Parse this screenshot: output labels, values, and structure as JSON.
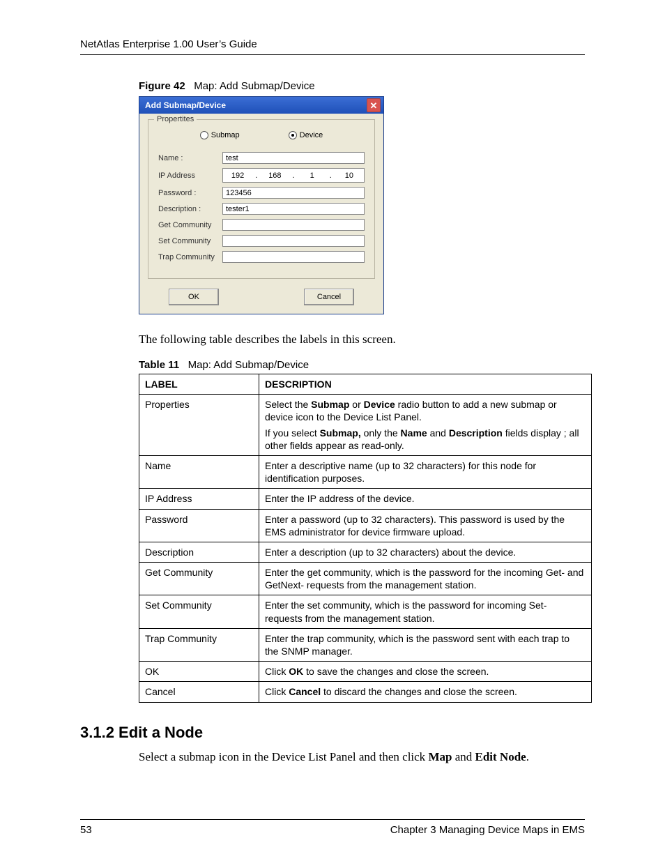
{
  "header": {
    "title": "NetAtlas Enterprise 1.00 User’s Guide"
  },
  "figure": {
    "label": "Figure 42",
    "caption": "Map: Add Submap/Device"
  },
  "dialog": {
    "title": "Add Submap/Device",
    "close_glyph": "✕",
    "fieldset_legend": "Propertites",
    "radio": {
      "submap": "Submap",
      "device": "Device"
    },
    "labels": {
      "name": "Name :",
      "ip": "IP Address",
      "password": "Password :",
      "description": "Description :",
      "get": "Get Community",
      "set": "Set Community",
      "trap": "Trap Community"
    },
    "values": {
      "name": "test",
      "ip": [
        "192",
        "168",
        "1",
        "10"
      ],
      "password": "123456",
      "description": "tester1",
      "get": "",
      "set": "",
      "trap": ""
    },
    "buttons": {
      "ok": "OK",
      "cancel": "Cancel"
    }
  },
  "intro_para": "The following table describes the labels in this screen.",
  "table": {
    "label": "Table 11",
    "caption": "Map: Add Submap/Device",
    "head": {
      "c1": "LABEL",
      "c2": "DESCRIPTION"
    },
    "rows": [
      {
        "label": "Properties",
        "desc_parts": [
          "Select the ",
          {
            "b": "Submap"
          },
          " or ",
          {
            "b": "Device"
          },
          " radio button to add a new submap or device icon to the Device List Panel."
        ],
        "desc2_parts": [
          "If you select ",
          {
            "b": "Submap,"
          },
          " only the ",
          {
            "b": "Name"
          },
          " and ",
          {
            "b": "Description"
          },
          " fields display ; all other fields appear as read-only."
        ]
      },
      {
        "label": "Name",
        "desc": "Enter a descriptive name (up to 32 characters) for this node for identification purposes."
      },
      {
        "label": "IP Address",
        "desc": "Enter the IP address of the device."
      },
      {
        "label": "Password",
        "desc": "Enter a password (up to 32 characters). This password is used by the EMS administrator for device firmware upload."
      },
      {
        "label": "Description",
        "desc": "Enter a description (up to 32 characters) about the device."
      },
      {
        "label": "Get Community",
        "desc": "Enter the get community, which is the password for the incoming Get- and GetNext- requests from the management station."
      },
      {
        "label": "Set Community",
        "desc": "Enter the set community, which is the password for incoming Set- requests from the management station."
      },
      {
        "label": "Trap Community",
        "desc": "Enter the trap community, which is the password sent with each trap to the SNMP manager."
      },
      {
        "label": "OK",
        "desc_parts": [
          "Click ",
          {
            "b": "OK"
          },
          " to save the changes and close the screen."
        ]
      },
      {
        "label": "Cancel",
        "desc_parts": [
          "Click ",
          {
            "b": "Cancel"
          },
          " to discard the changes and close the screen."
        ]
      }
    ]
  },
  "section": {
    "heading": "3.1.2  Edit a Node",
    "para_parts": [
      "Select a submap icon in the Device List Panel and then click ",
      {
        "b": "Map"
      },
      " and ",
      {
        "b": "Edit Node"
      },
      "."
    ]
  },
  "footer": {
    "page": "53",
    "chapter": "Chapter 3 Managing Device Maps in EMS"
  }
}
